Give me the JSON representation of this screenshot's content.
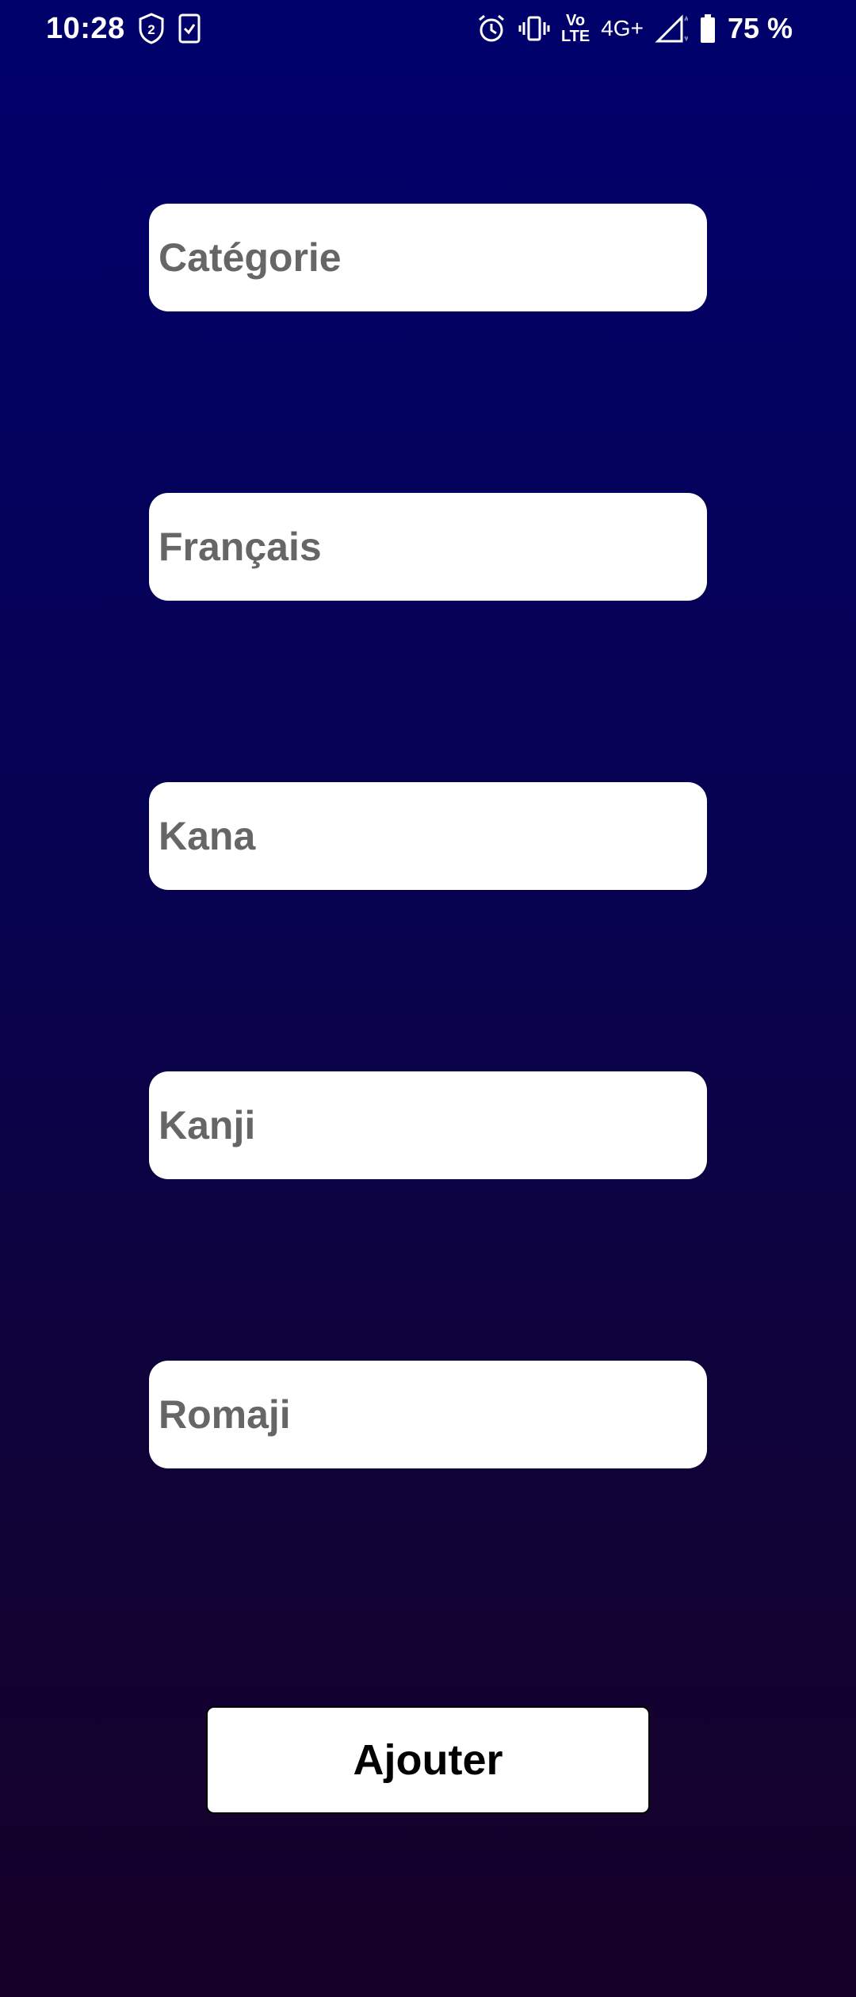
{
  "status_bar": {
    "time": "10:28",
    "network": "4G+",
    "volte_top": "Vo",
    "volte_bottom": "LTE",
    "battery": "75 %",
    "icons": [
      "vpn-shield-icon",
      "task-check-icon",
      "alarm-icon",
      "vibrate-icon",
      "volte-icon",
      "signal-icon",
      "battery-icon"
    ]
  },
  "form": {
    "categorie": {
      "placeholder": "Catégorie",
      "value": ""
    },
    "francais": {
      "placeholder": "Français",
      "value": ""
    },
    "kana": {
      "placeholder": "Kana",
      "value": ""
    },
    "kanji": {
      "placeholder": "Kanji",
      "value": ""
    },
    "romaji": {
      "placeholder": "Romaji",
      "value": ""
    }
  },
  "actions": {
    "add_label": "Ajouter"
  },
  "colors": {
    "background_top": "#00006b",
    "background_bottom": "#160028",
    "field_bg": "#ffffff",
    "placeholder": "#666666",
    "button_text": "#000000"
  }
}
